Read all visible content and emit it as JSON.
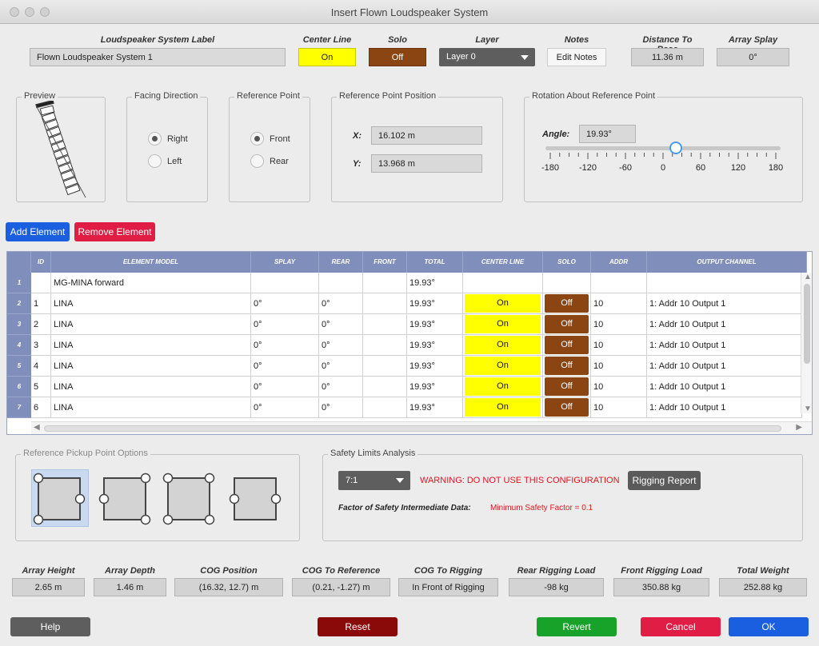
{
  "window": {
    "title": "Insert Flown Loudspeaker System"
  },
  "top": {
    "system_label": {
      "label": "Loudspeaker System Label",
      "value": "Flown Loudspeaker System 1"
    },
    "center_line": {
      "label": "Center Line",
      "value": "On"
    },
    "solo": {
      "label": "Solo",
      "value": "Off"
    },
    "layer": {
      "label": "Layer",
      "value": "Layer 0"
    },
    "notes": {
      "label": "Notes",
      "button": "Edit Notes"
    },
    "distance_to_base": {
      "label": "Distance To Base",
      "value": "11.36 m"
    },
    "array_splay": {
      "label": "Array Splay",
      "value": "0°"
    }
  },
  "preview": {
    "title": "Preview"
  },
  "facing": {
    "title": "Facing Direction",
    "options": [
      "Right",
      "Left"
    ],
    "selected": "Right"
  },
  "reference_point": {
    "title": "Reference Point",
    "options": [
      "Front",
      "Rear"
    ],
    "selected": "Front"
  },
  "ref_position": {
    "title": "Reference Point Position",
    "x_label": "X:",
    "x_value": "16.102 m",
    "y_label": "Y:",
    "y_value": "13.968 m"
  },
  "rotation": {
    "title": "Rotation About Reference Point",
    "angle_label": "Angle:",
    "angle_value": "19.93°",
    "slider_min": -180,
    "slider_max": 180,
    "slider_value": 19.93,
    "ticks": [
      "-180",
      "-120",
      "-60",
      "0",
      "60",
      "120",
      "180"
    ]
  },
  "actions": {
    "add": "Add Element",
    "remove": "Remove Element"
  },
  "table": {
    "headers": [
      "ID",
      "ELEMENT MODEL",
      "SPLAY",
      "REAR",
      "FRONT",
      "TOTAL",
      "CENTER LINE",
      "SOLO",
      "ADDR",
      "OUTPUT CHANNEL"
    ],
    "rows": [
      {
        "num": "1",
        "id": "",
        "model": "MG-MINA forward",
        "splay": "",
        "rear": "",
        "front": "",
        "total": "19.93°",
        "center": "",
        "solo": "",
        "addr": "",
        "output": ""
      },
      {
        "num": "2",
        "id": "1",
        "model": "LINA",
        "splay": "0°",
        "rear": "0°",
        "front": "",
        "total": "19.93°",
        "center": "On",
        "solo": "Off",
        "addr": "10",
        "output": "1: Addr 10 Output 1"
      },
      {
        "num": "3",
        "id": "2",
        "model": "LINA",
        "splay": "0°",
        "rear": "0°",
        "front": "",
        "total": "19.93°",
        "center": "On",
        "solo": "Off",
        "addr": "10",
        "output": "1: Addr 10 Output 1"
      },
      {
        "num": "4",
        "id": "3",
        "model": "LINA",
        "splay": "0°",
        "rear": "0°",
        "front": "",
        "total": "19.93°",
        "center": "On",
        "solo": "Off",
        "addr": "10",
        "output": "1: Addr 10 Output 1"
      },
      {
        "num": "5",
        "id": "4",
        "model": "LINA",
        "splay": "0°",
        "rear": "0°",
        "front": "",
        "total": "19.93°",
        "center": "On",
        "solo": "Off",
        "addr": "10",
        "output": "1: Addr 10 Output 1"
      },
      {
        "num": "6",
        "id": "5",
        "model": "LINA",
        "splay": "0°",
        "rear": "0°",
        "front": "",
        "total": "19.93°",
        "center": "On",
        "solo": "Off",
        "addr": "10",
        "output": "1: Addr 10 Output 1"
      },
      {
        "num": "7",
        "id": "6",
        "model": "LINA",
        "splay": "0°",
        "rear": "0°",
        "front": "",
        "total": "19.93°",
        "center": "On",
        "solo": "Off",
        "addr": "10",
        "output": "1: Addr 10 Output 1"
      }
    ]
  },
  "pickup": {
    "title": "Reference Pickup Point Options"
  },
  "safety": {
    "title": "Safety Limits Analysis",
    "ratio": "7:1",
    "warning": "WARNING: DO NOT USE THIS CONFIGURATION",
    "report_button": "Rigging Report",
    "factor_label": "Factor of Safety Intermediate Data:",
    "factor_value": "Minimum Safety Factor = 0.1"
  },
  "summary": {
    "array_height": {
      "label": "Array Height",
      "value": "2.65 m"
    },
    "array_depth": {
      "label": "Array Depth",
      "value": "1.46 m"
    },
    "cog_position": {
      "label": "COG Position",
      "value": "(16.32, 12.7)  m"
    },
    "cog_reference": {
      "label": "COG To Reference",
      "value": "(0.21, -1.27)  m"
    },
    "cog_rigging": {
      "label": "COG To Rigging",
      "value": "In Front of Rigging"
    },
    "rear_load": {
      "label": "Rear Rigging Load",
      "value": "-98 kg"
    },
    "front_load": {
      "label": "Front Rigging Load",
      "value": "350.88 kg"
    },
    "total_weight": {
      "label": "Total Weight",
      "value": "252.88 kg"
    }
  },
  "footer": {
    "help": "Help",
    "reset": "Reset",
    "revert": "Revert",
    "cancel": "Cancel",
    "ok": "OK"
  },
  "colors": {
    "on": "#ffff00",
    "off": "#8b4513",
    "header": "#7f8eba",
    "warning": "#e0161f",
    "ok": "#1a5fe0",
    "revert": "#17a32a",
    "cancel": "#e01e45",
    "reset": "#8a0a0a",
    "add": "#1a5fe0",
    "remove": "#e01e45"
  }
}
